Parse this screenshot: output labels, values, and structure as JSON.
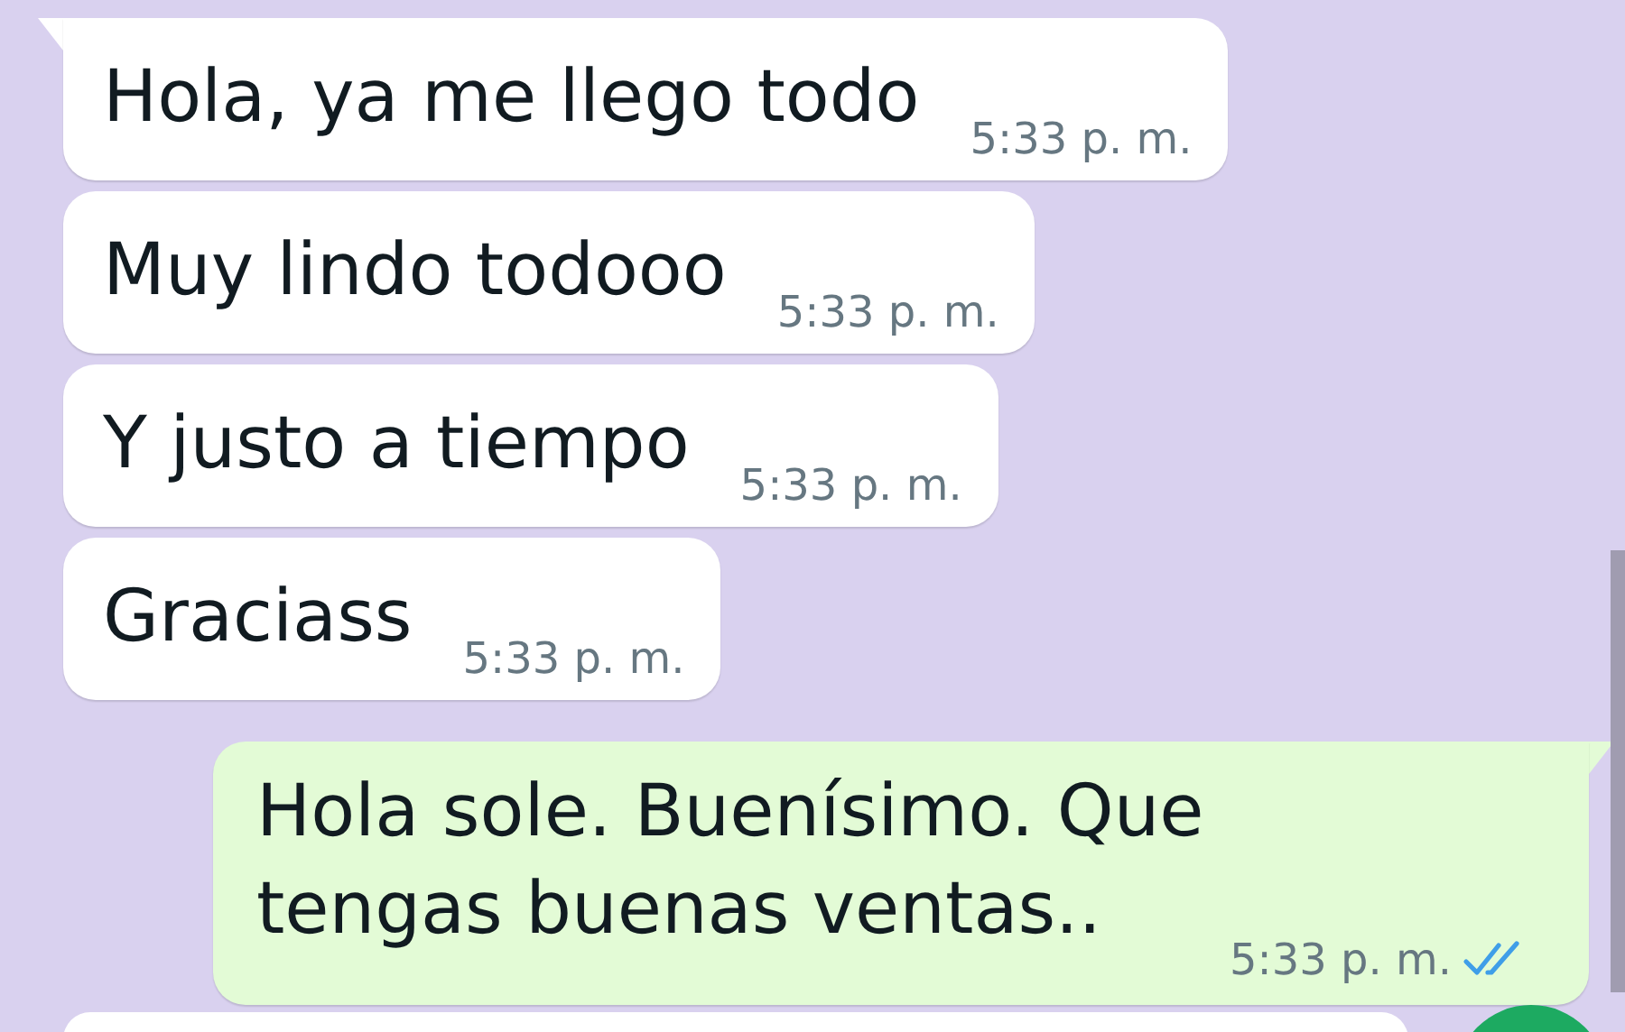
{
  "messages": [
    {
      "outgoing": false,
      "tail": true,
      "text": "Hola, ya me llego todo",
      "time": "5:33 p. m."
    },
    {
      "outgoing": false,
      "tail": false,
      "text": "Muy lindo todooo",
      "time": "5:33 p. m."
    },
    {
      "outgoing": false,
      "tail": false,
      "text": "Y justo a tiempo",
      "time": "5:33 p. m."
    },
    {
      "outgoing": false,
      "tail": false,
      "text": "Graciass",
      "time": "5:33 p. m."
    },
    {
      "outgoing": true,
      "tail": true,
      "text": "Hola sole. Buenísimo. Que tengas buenas ventas..",
      "time": "5:33 p. m.",
      "read": true
    }
  ]
}
